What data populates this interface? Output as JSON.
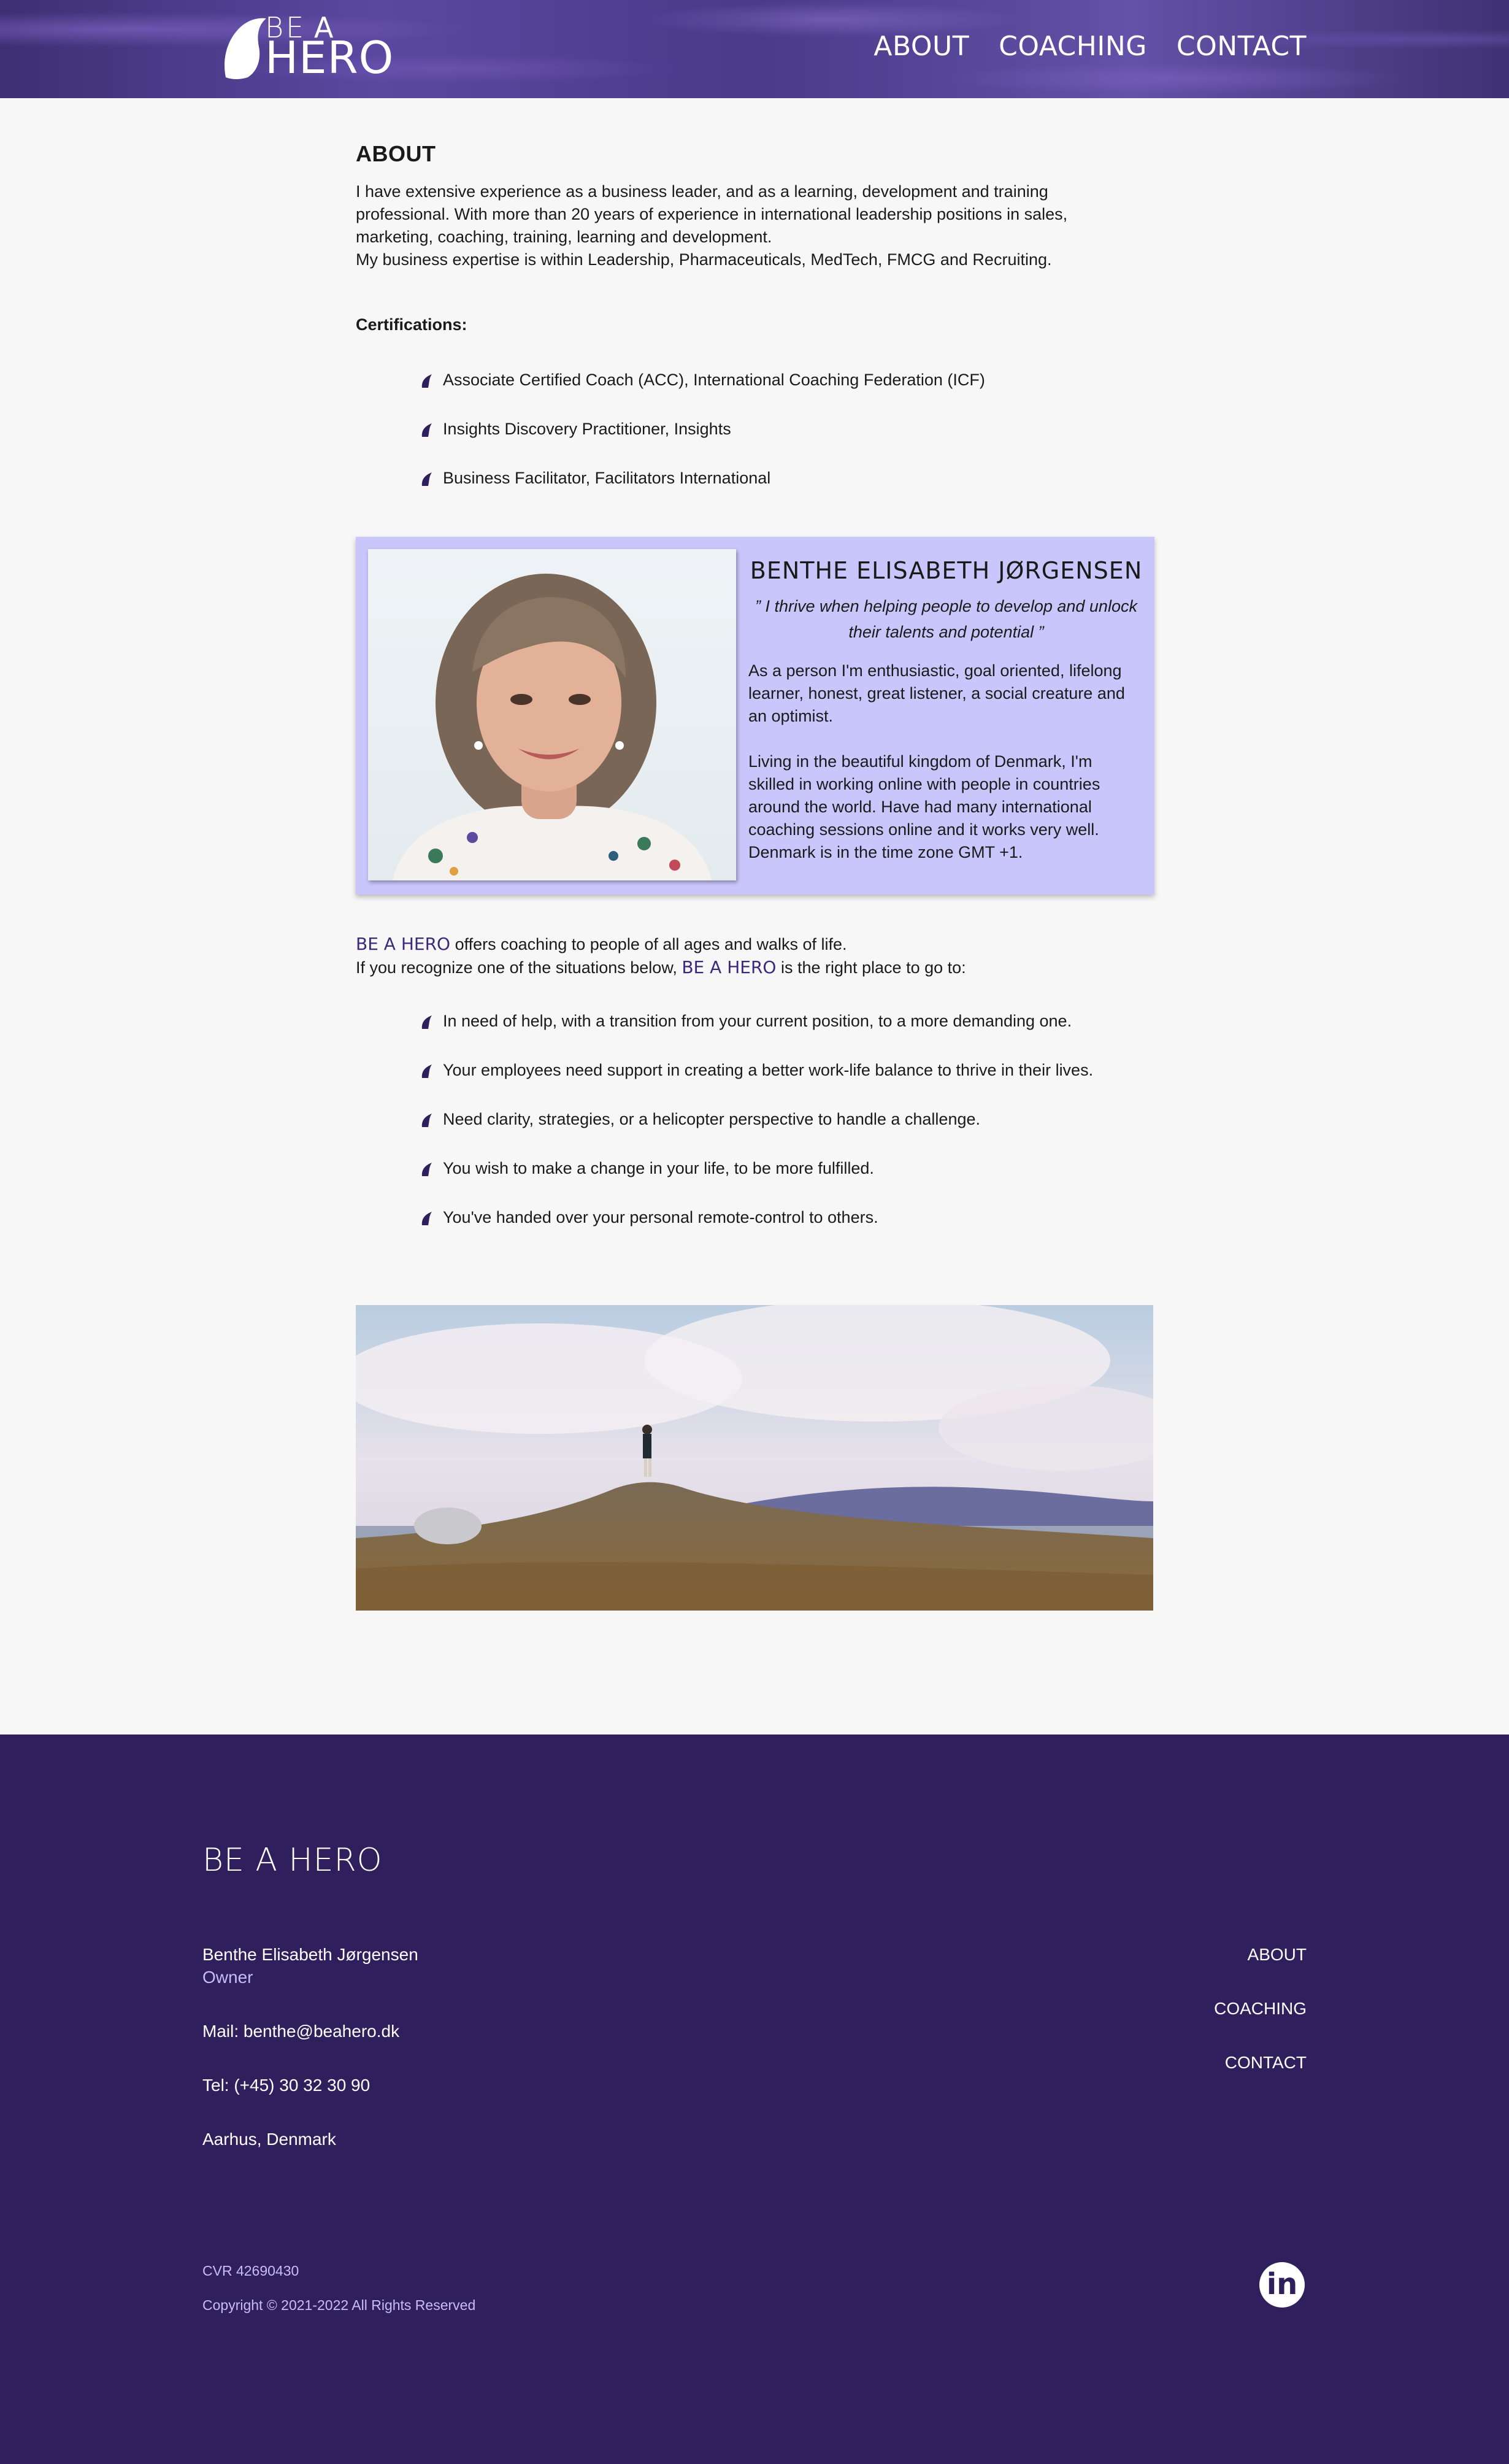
{
  "header": {
    "logo": {
      "be": "BE",
      "a": "A",
      "hero": "HERO"
    },
    "nav": [
      "ABOUT",
      "COACHING",
      "CONTACT"
    ]
  },
  "about": {
    "heading": "ABOUT",
    "lines": [
      "I have extensive experience as a business leader, and as a learning, development and training",
      "professional. With more than 20 years of experience in international leadership positions in sales,",
      "marketing, coaching, training, learning and development.",
      "My business expertise is within Leadership, Pharmaceuticals, MedTech, FMCG and Recruiting."
    ],
    "cert_title": "Certifications:",
    "certs": [
      "Associate Certified Coach (ACC), International Coaching Federation (ICF)",
      "Insights Discovery Practitioner, Insights",
      "Business Facilitator, Facilitators International"
    ]
  },
  "profile": {
    "name": "BENTHE ELISABETH JØRGENSEN",
    "quote_l1": "” I thrive when helping people to develop and unlock",
    "quote_l2": "their talents and potential ”",
    "p1": [
      "As a person I'm enthusiastic, goal oriented, lifelong",
      "learner, honest, great listener, a social creature and",
      "an optimist."
    ],
    "p2": [
      "Living in the beautiful kingdom of Denmark, I'm",
      "skilled in working online with people in countries",
      "around the world. Have had many international",
      "coaching sessions online and it works very well.",
      "Denmark is in the time zone GMT +1."
    ]
  },
  "offer": {
    "brand": "BE A HERO",
    "line1_rest": " offers coaching to people of all ages and walks of life.",
    "line2_pre": "If you recognize one of the situations below, ",
    "line2_post": " is the right place to go to:",
    "situations": [
      "In need of help, with a transition from your current position, to a more demanding one.",
      "Your employees need support in creating a better work-life balance to thrive in their lives.",
      "Need clarity, strategies, or a helicopter perspective to handle a challenge.",
      "You wish to make a change in your life, to be more fulfilled.",
      "You've handed over your personal remote-control to others."
    ]
  },
  "footer": {
    "logo": "BE A HERO",
    "name": "Benthe Elisabeth Jørgensen",
    "role": "Owner",
    "mail": "Mail: benthe@beahero.dk",
    "tel": "Tel: (+45) 30 32 30 90",
    "city": "Aarhus, Denmark",
    "nav": [
      "ABOUT",
      "COACHING",
      "CONTACT"
    ],
    "cvr": "CVR 42690430",
    "copyright": "Copyright © 2021-2022 All Rights Reserved",
    "social": "in"
  },
  "colors": {
    "accent": "#2f1f5c",
    "card": "#c9c6fb",
    "brand_text": "#3b2a7a"
  }
}
